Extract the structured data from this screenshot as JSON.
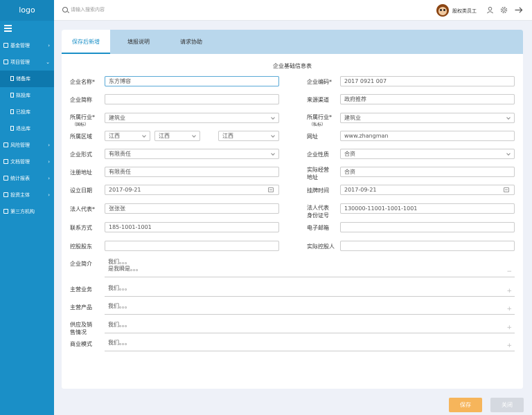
{
  "app": {
    "logo": "logo"
  },
  "header": {
    "search_placeholder": "请输入搜索内容",
    "user_name": "股权类员工"
  },
  "sidebar": {
    "items": [
      {
        "label": "基金管理",
        "arrow": "›"
      },
      {
        "label": "项目管理",
        "arrow": "⌄"
      },
      {
        "label": "风险管理",
        "arrow": "›"
      },
      {
        "label": "文档管理",
        "arrow": "›"
      },
      {
        "label": "统计报表",
        "arrow": "›"
      },
      {
        "label": "投资主体",
        "arrow": "›"
      },
      {
        "label": "第三方机构",
        "arrow": ""
      }
    ],
    "subitems": [
      {
        "label": "储备库"
      },
      {
        "label": "拟投库"
      },
      {
        "label": "已投库"
      },
      {
        "label": "退出库"
      }
    ]
  },
  "tabs": [
    {
      "label": "保存后新增"
    },
    {
      "label": "填报说明"
    },
    {
      "label": "请求协助"
    }
  ],
  "form": {
    "title": "企业基础信息表",
    "labels": {
      "company_name": "企业名称*",
      "company_code": "企业编码*",
      "short_name": "企业简称",
      "source": "来源渠道",
      "industry_nat": "所属行业*",
      "industry_nat_sub": "（国标）",
      "industry_priv": "所属行业*",
      "industry_priv_sub": "（私标）",
      "region": "所属区域",
      "website": "网址",
      "company_form": "企业形式",
      "company_nature": "企业性质",
      "reg_address": "注册地址",
      "biz_address_1": "实际经营",
      "biz_address_2": "地址",
      "found_date": "设立日期",
      "listing_time": "挂牌时间",
      "legal_rep": "法人代表*",
      "legal_id_1": "法人代表",
      "legal_id_2": "身份证号",
      "contact": "联系方式",
      "email": "电子邮箱",
      "controlling_holder": "控股股东",
      "actual_controller": "实际控股人",
      "intro": "企业简介",
      "main_business": "主营业务",
      "main_products": "主营产品",
      "supply_1": "供应及销",
      "supply_2": "售情况",
      "business_model": "商业模式"
    },
    "values": {
      "company_name": "东方博容",
      "company_code": "2017 0921 007",
      "short_name": "",
      "source": "政府推荐",
      "industry_nat": "建筑业",
      "industry_priv": "建筑业",
      "region_1": "江西",
      "region_2": "江西",
      "region_3": "江西",
      "website": "www.zhangman",
      "company_form": "有限责任",
      "company_nature": "合资",
      "reg_address": "有限责任",
      "biz_address": "合资",
      "found_date": "2017-09-21",
      "listing_time": "2017-09-21",
      "legal_rep": "张张张",
      "legal_id": "130000-11001-1001-1001",
      "contact": "185-1001-1001",
      "email": "",
      "controlling_holder": "",
      "actual_controller": "",
      "intro_1": "我们。。。",
      "intro_2": "是我瞬是。。。",
      "main_business": "我们。。。",
      "main_products": "我们。。。",
      "supply": "我们。。。",
      "business_model": "我们。。。",
      "collapse_mark": "−",
      "expand_mark": "+"
    }
  },
  "buttons": {
    "save": "保存",
    "close": "关闭"
  },
  "colors": {
    "sidebar": "#1a8fc7",
    "tab_bar": "#b9d7ec",
    "save": "#f6b55b",
    "close": "#d5d9e0"
  }
}
